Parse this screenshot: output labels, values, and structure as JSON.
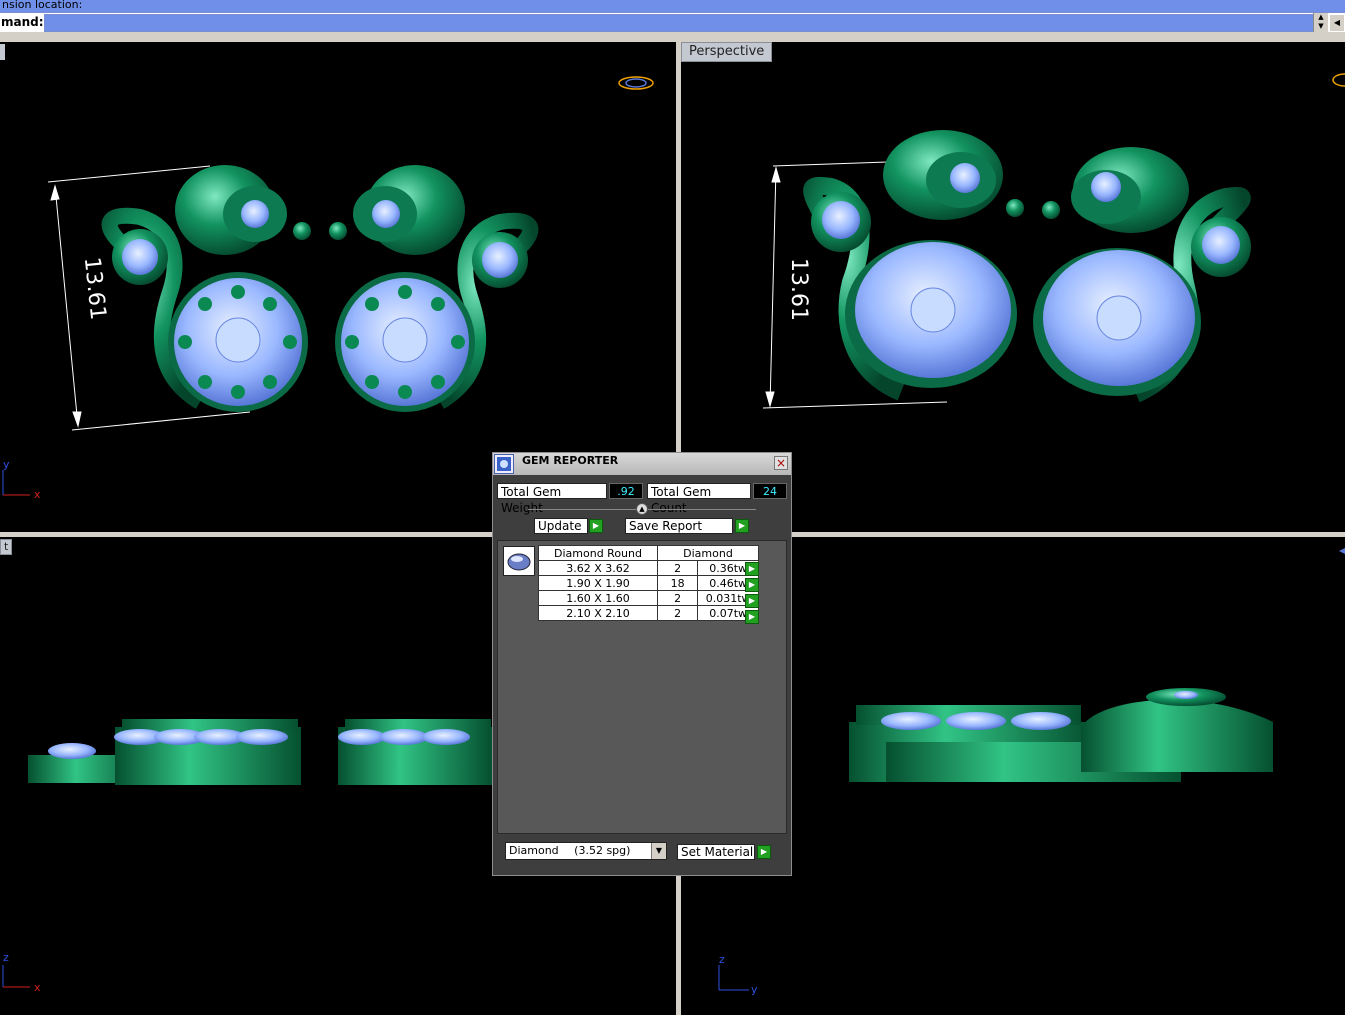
{
  "command_area": {
    "prompt_text": "nsion location:",
    "command_label": "mand:",
    "command_value": ""
  },
  "viewports": {
    "top_label": "",
    "perspective_label": "Perspective",
    "front_label": "t",
    "dimension_text": "13.61",
    "axes": {
      "x": "x",
      "y": "y",
      "z": "z"
    }
  },
  "gem_reporter": {
    "title": "GEM REPORTER",
    "total_weight_label": "Total Gem Weight",
    "total_weight_value": ".92",
    "total_count_label": "Total Gem Count",
    "total_count_value": "24",
    "update_label": "Update",
    "save_report_label": "Save Report",
    "table_headers": [
      "Diamond Round",
      "Diamond"
    ],
    "rows": [
      {
        "size": "3.62 X 3.62",
        "count": "2",
        "weight": "0.36tw"
      },
      {
        "size": "1.90 X 1.90",
        "count": "18",
        "weight": "0.46tw"
      },
      {
        "size": "1.60 X 1.60",
        "count": "2",
        "weight": "0.031tw"
      },
      {
        "size": "2.10 X 2.10",
        "count": "2",
        "weight": "0.07tw"
      }
    ],
    "material_name": "Diamond",
    "material_density": "(3.52 spg)",
    "set_material_label": "Set Material"
  },
  "colors": {
    "metal": "#0f8a5e",
    "gem": "#9ab8ff",
    "viewport_bg": "#000000",
    "ui_gray": "#d4d0c8"
  }
}
